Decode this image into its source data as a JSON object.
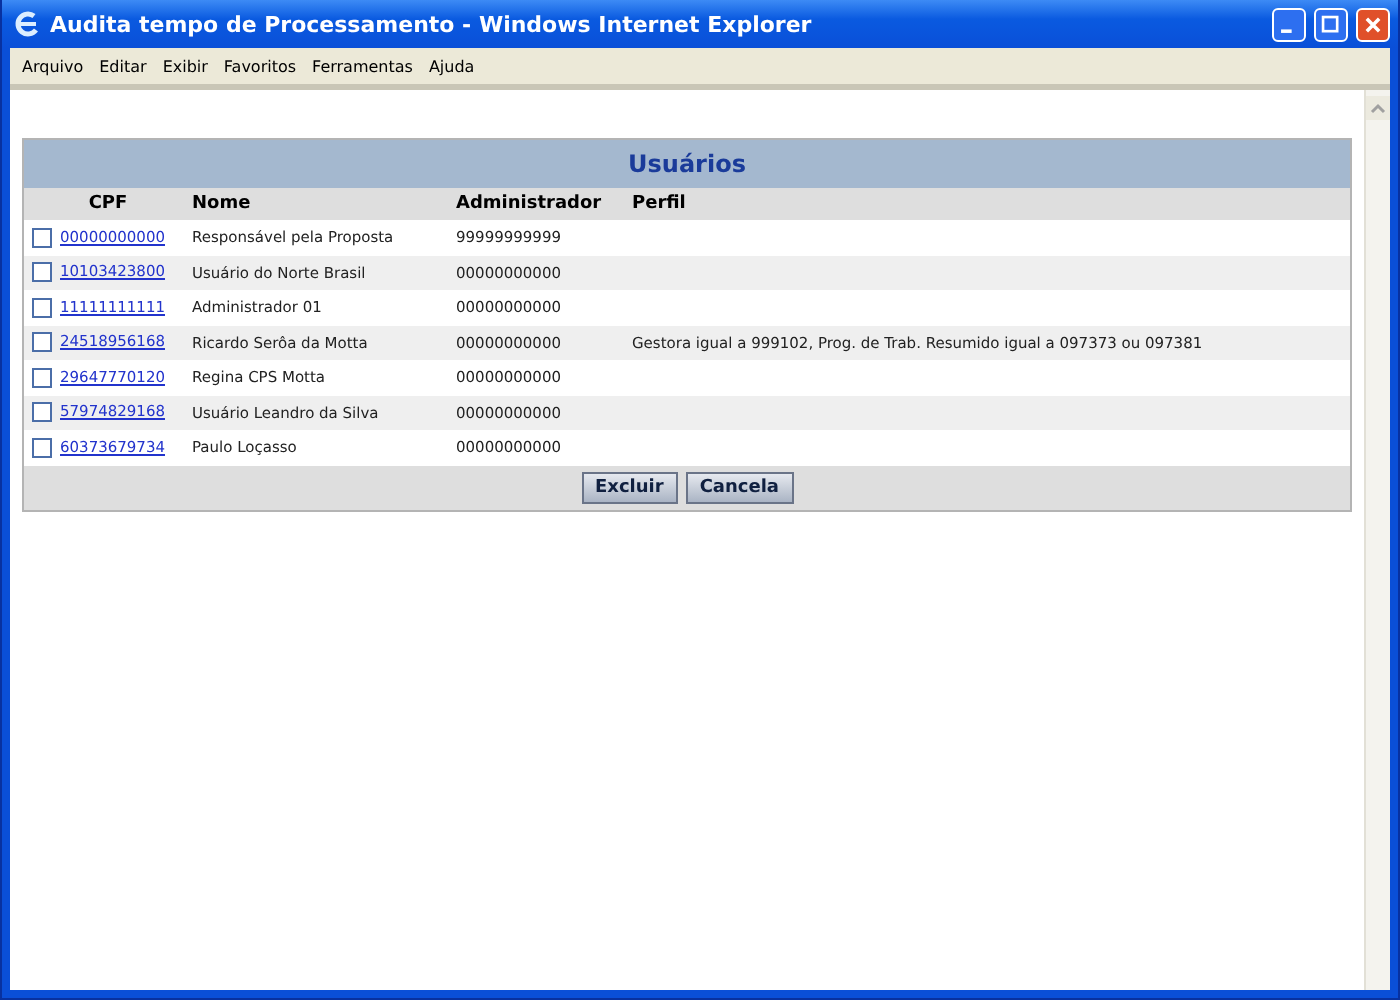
{
  "window": {
    "title": "Audita tempo de Processamento - Windows Internet Explorer"
  },
  "menu": [
    "Arquivo",
    "Editar",
    "Exibir",
    "Favoritos",
    "Ferramentas",
    "Ajuda"
  ],
  "panel": {
    "title": "Usuários",
    "columns": [
      "CPF",
      "Nome",
      "Administrador",
      "Perfil"
    ],
    "rows": [
      {
        "checked": false,
        "cpf": "00000000000",
        "nome": "Responsável pela Proposta",
        "administrador": "99999999999",
        "perfil": ""
      },
      {
        "checked": false,
        "cpf": "10103423800",
        "nome": "Usuário do Norte Brasil",
        "administrador": "00000000000",
        "perfil": ""
      },
      {
        "checked": false,
        "cpf": "11111111111",
        "nome": "Administrador 01",
        "administrador": "00000000000",
        "perfil": ""
      },
      {
        "checked": false,
        "cpf": "24518956168",
        "nome": "Ricardo Serôa da Motta",
        "administrador": "00000000000",
        "perfil": "Gestora igual a 999102, Prog. de Trab. Resumido igual a 097373 ou 097381"
      },
      {
        "checked": false,
        "cpf": "29647770120",
        "nome": "Regina CPS Motta",
        "administrador": "00000000000",
        "perfil": ""
      },
      {
        "checked": false,
        "cpf": "57974829168",
        "nome": "Usuário Leandro da Silva",
        "administrador": "00000000000",
        "perfil": ""
      },
      {
        "checked": false,
        "cpf": "60373679734",
        "nome": "Paulo Loçasso",
        "administrador": "00000000000",
        "perfil": ""
      }
    ],
    "buttons": [
      "Excluir",
      "Cancela"
    ]
  }
}
